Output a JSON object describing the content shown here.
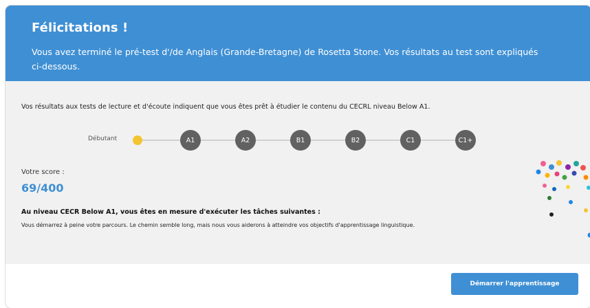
{
  "header": {
    "title": "Félicitations !",
    "message": "Vous avez terminé le pré-test d'/de Anglais (Grande-Bretagne) de Rosetta Stone. Vos résultats au test sont expliqués ci-dessous."
  },
  "results": {
    "summary": "Vos résultats aux tests de lecture et d'écoute indiquent que vous êtes prêt à étudier le contenu du CECRL niveau Below A1.",
    "scale_start_label": "Débutant",
    "levels": [
      "A1",
      "A2",
      "B1",
      "B2",
      "C1",
      "C1+"
    ],
    "score_label": "Votre score :",
    "score_value": "69/400",
    "tasks_title": "Au niveau CECR Below A1, vous êtes en mesure d'exécuter les tâches suivantes :",
    "tasks_text": "Vous démarrez à peine votre parcours. Le chemin semble long, mais nous vous aiderons à atteindre vos objectifs d'apprentissage linguistique."
  },
  "footer": {
    "start_button": "Démarrer l'apprentissage"
  },
  "colors": {
    "accent": "#3f8fd4",
    "current_level": "#f4c430",
    "level_badge": "#616161"
  },
  "icons": {
    "confetti": "confetti-icon"
  }
}
